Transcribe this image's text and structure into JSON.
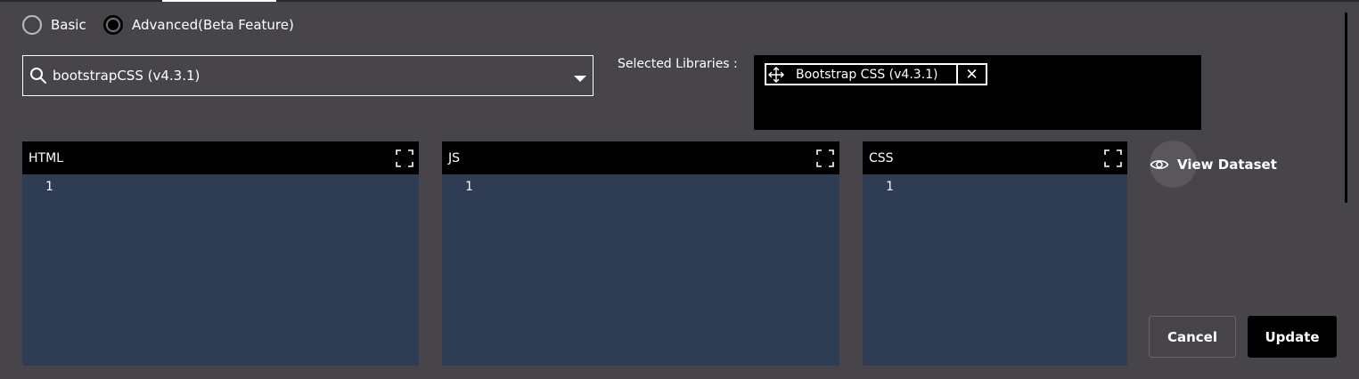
{
  "mode": {
    "options": [
      {
        "label": "Basic",
        "selected": false
      },
      {
        "label": "Advanced(Beta Feature)",
        "selected": true
      }
    ]
  },
  "library_search": {
    "value": "bootstrapCSS (v4.3.1)",
    "icon": "search-icon"
  },
  "selected_libraries": {
    "label": "Selected Libraries :",
    "items": [
      {
        "name": "Bootstrap CSS (v4.3.1)",
        "remove_symbol": "✕"
      }
    ]
  },
  "editors": [
    {
      "title": "HTML",
      "line": "1"
    },
    {
      "title": "JS",
      "line": "1"
    },
    {
      "title": "CSS",
      "line": "1"
    }
  ],
  "view_dataset": {
    "label": "View Dataset",
    "icon": "eye-icon"
  },
  "actions": {
    "cancel_label": "Cancel",
    "update_label": "Update"
  },
  "colors": {
    "background": "#48454a",
    "editor_body": "#2e3d53",
    "editor_header": "#000000",
    "primary_button": "#000000"
  }
}
